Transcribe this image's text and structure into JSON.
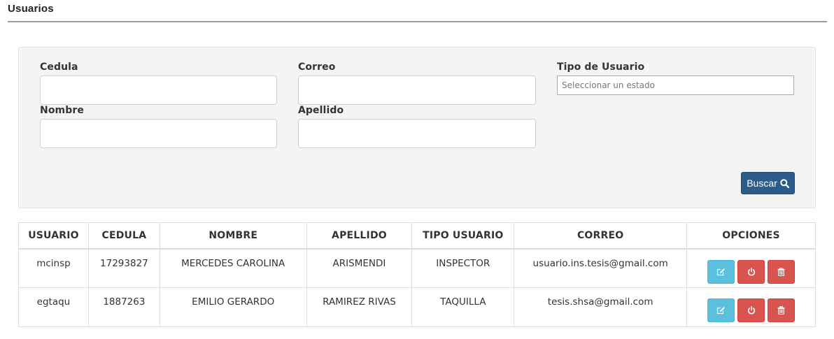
{
  "page": {
    "title": "Usuarios"
  },
  "filters": {
    "cedula": {
      "label": "Cedula",
      "value": ""
    },
    "correo": {
      "label": "Correo",
      "value": ""
    },
    "tipo_usuario": {
      "label": "Tipo de Usuario",
      "placeholder": "Seleccionar un estado"
    },
    "nombre": {
      "label": "Nombre",
      "value": ""
    },
    "apellido": {
      "label": "Apellido",
      "value": ""
    },
    "search_button": "Buscar"
  },
  "table": {
    "headers": [
      "USUARIO",
      "CEDULA",
      "NOMBRE",
      "APELLIDO",
      "TIPO USUARIO",
      "CORREO",
      "OPCIONES"
    ],
    "rows": [
      {
        "usuario": "mcinsp",
        "cedula": "17293827",
        "nombre": "MERCEDES CAROLINA",
        "apellido": "ARISMENDI",
        "tipo": "INSPECTOR",
        "correo": "usuario.ins.tesis@gmail.com"
      },
      {
        "usuario": "egtaqu",
        "cedula": "1887263",
        "nombre": "EMILIO GERARDO",
        "apellido": "RAMIREZ RIVAS",
        "tipo": "TAQUILLA",
        "correo": "tesis.shsa@gmail.com"
      }
    ],
    "row_actions": [
      "edit-icon",
      "power-icon",
      "trash-icon"
    ]
  },
  "colors": {
    "primary": "#2b5c8a",
    "info": "#5bc0de",
    "danger": "#d9534f",
    "panel": "#f4f4f4"
  }
}
